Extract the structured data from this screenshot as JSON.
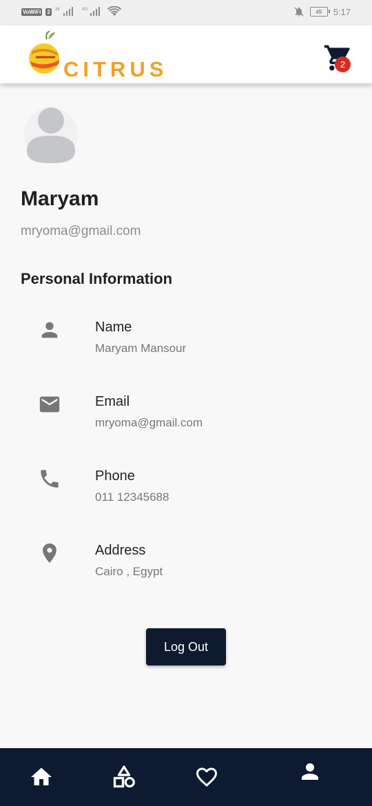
{
  "status_bar": {
    "volte_label": "VoWiFi",
    "sim_label": "2",
    "signal_1": "36",
    "signal_2": "4G",
    "battery": "49",
    "time": "5:17"
  },
  "app_bar": {
    "brand": "CITRUS",
    "cart_count": "2"
  },
  "profile": {
    "name": "Maryam",
    "email": "mryoma@gmail.com",
    "section_title": "Personal Information",
    "items": [
      {
        "icon": "person-icon",
        "label": "Name",
        "value": "Maryam Mansour"
      },
      {
        "icon": "mail-icon",
        "label": "Email",
        "value": "mryoma@gmail.com"
      },
      {
        "icon": "phone-icon",
        "label": "Phone",
        "value": "011 12345688"
      },
      {
        "icon": "location-pin-icon",
        "label": "Address",
        "value": "Cairo , Egypt"
      }
    ],
    "logout_label": "Log Out"
  },
  "bottom_nav": {
    "items": [
      "home-icon",
      "categories-icon",
      "favorites-icon",
      "profile-icon"
    ],
    "active": "profile-icon"
  },
  "colors": {
    "brand_orange": "#f2a024",
    "dark_navy": "#0d1a31",
    "badge_red": "#d92b22",
    "icon_gray": "#777777"
  }
}
